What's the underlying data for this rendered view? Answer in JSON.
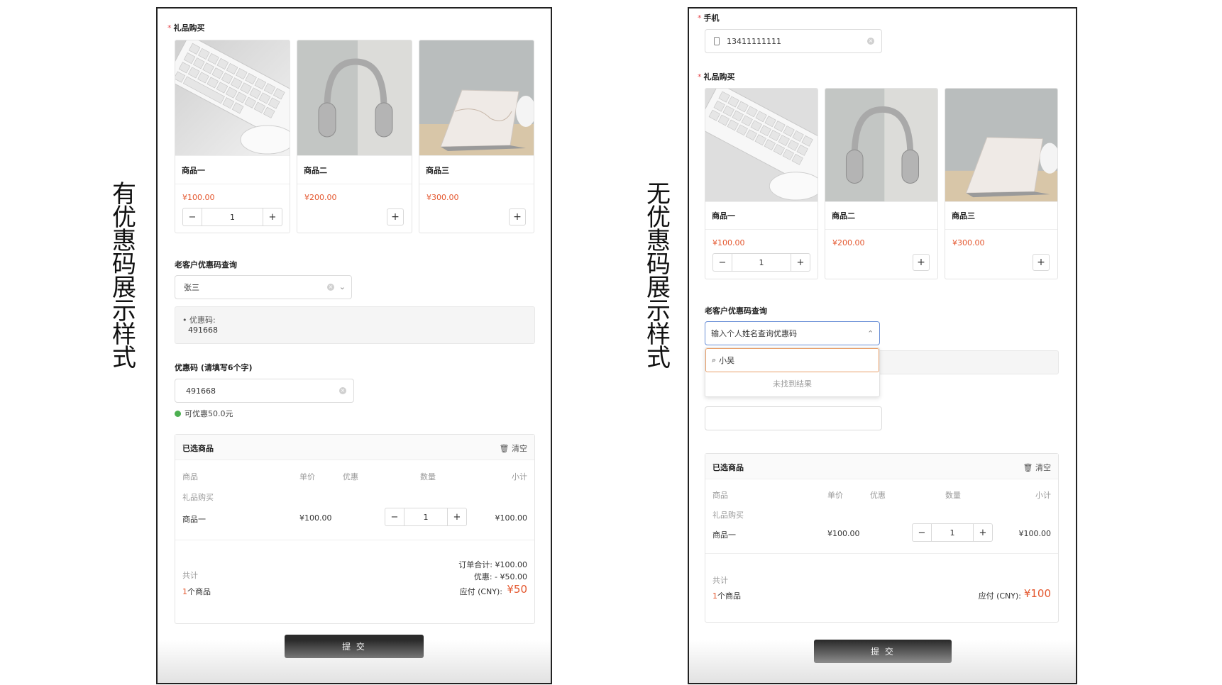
{
  "labels": {
    "left": "有\n优\n惠\n码\n展\n示\n样\n式",
    "right": "无\n优\n惠\n码\n展\n示\n样\n式"
  },
  "left": {
    "gift_label": "礼品购买",
    "products": [
      {
        "name": "商品一",
        "price": "¥100.00",
        "qty": "1"
      },
      {
        "name": "商品二",
        "price": "¥200.00"
      },
      {
        "name": "商品三",
        "price": "¥300.00"
      }
    ],
    "lookup_label": "老客户优惠码查询",
    "lookup_value": "张三",
    "coupon_result_label": "• 优惠码:",
    "coupon_result_value": "491668",
    "code_label": "优惠码 (请填写6个字)",
    "code_value": "491668",
    "code_ok": "可优惠50.0元",
    "selected": {
      "title": "已选商品",
      "clear": "清空",
      "headers": {
        "product": "商品",
        "unit": "单价",
        "discount": "优惠",
        "qty": "数量",
        "subtotal": "小计"
      },
      "group": "礼品购买",
      "row": {
        "name": "商品一",
        "unit": "¥100.00",
        "qty": "1",
        "subtotal": "¥100.00"
      },
      "total_label": "共计",
      "count": "1",
      "count_suffix": "个商品",
      "order_total": "订单合计:  ¥100.00",
      "discount_line": "优惠: - ¥50.00",
      "pay_label": "应付 (CNY):",
      "pay_value": "¥50"
    },
    "submit": "提 交"
  },
  "right": {
    "phone_label": "手机",
    "phone_value": "13411111111",
    "gift_label": "礼品购买",
    "products": [
      {
        "name": "商品一",
        "price": "¥100.00",
        "qty": "1"
      },
      {
        "name": "商品二",
        "price": "¥200.00"
      },
      {
        "name": "商品三",
        "price": "¥300.00"
      }
    ],
    "lookup_label": "老客户优惠码查询",
    "lookup_placeholder": "输入个人姓名查询优惠码",
    "search_value": "小吴",
    "no_result": "未找到结果",
    "selected": {
      "title": "已选商品",
      "clear": "清空",
      "headers": {
        "product": "商品",
        "unit": "单价",
        "discount": "优惠",
        "qty": "数量",
        "subtotal": "小计"
      },
      "group": "礼品购买",
      "row": {
        "name": "商品一",
        "unit": "¥100.00",
        "qty": "1",
        "subtotal": "¥100.00"
      },
      "total_label": "共计",
      "count": "1",
      "count_suffix": "个商品",
      "pay_label": "应付 (CNY):",
      "pay_value": "¥100"
    },
    "submit": "提 交"
  },
  "colors": {
    "accent": "#e4572e",
    "button": "#2b2b2b",
    "success": "#4caf50",
    "required": "#e5484d"
  },
  "icons": {
    "product_1": "keyboard-image",
    "product_2": "headphones-image",
    "product_3": "laptop-image"
  }
}
